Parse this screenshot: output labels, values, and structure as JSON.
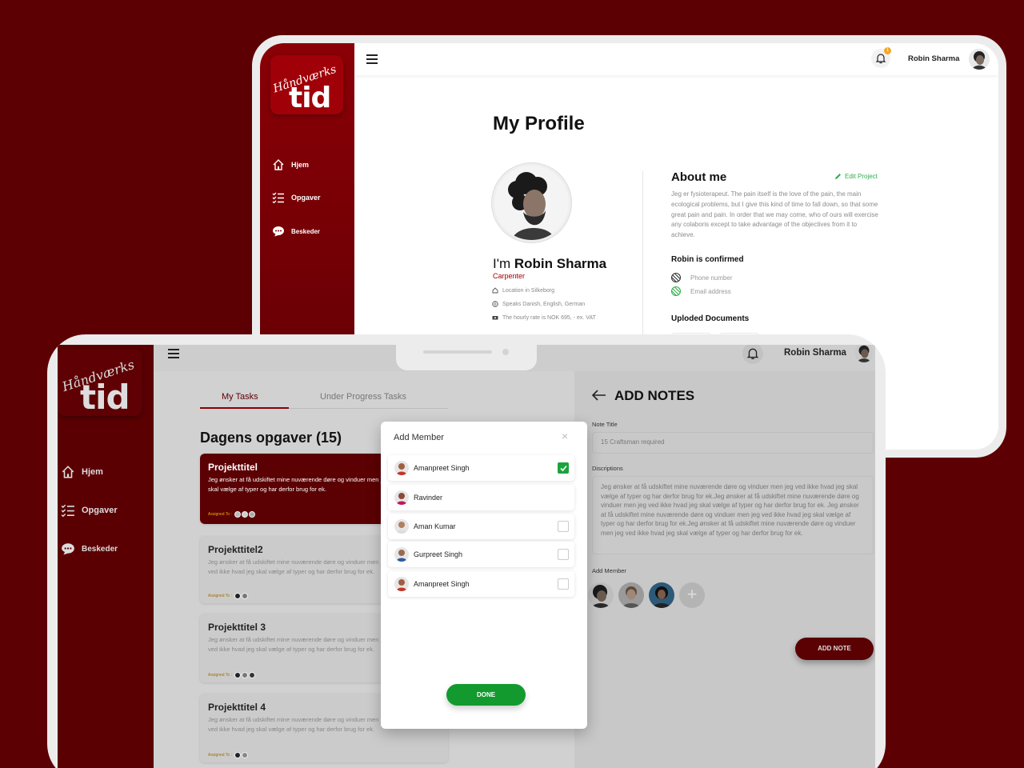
{
  "brand": {
    "script": "Håndværks",
    "big": "tid"
  },
  "nav": [
    {
      "label": "Hjem",
      "icon": "home-icon"
    },
    {
      "label": "Opgaver",
      "icon": "checklist-icon"
    },
    {
      "label": "Beskeder",
      "icon": "chat-icon"
    }
  ],
  "header": {
    "user_name": "Robin  Sharma",
    "notification_count": "1"
  },
  "profile": {
    "title": "My Profile",
    "im_prefix": "I'm",
    "name": "Robin Sharma",
    "role": "Carpenter",
    "location": "Location in Silkeborg",
    "languages": "Speaks Danish, English, German",
    "rate": "The hourly rate is NOK 695, - ex. VAT",
    "about_heading": "About me",
    "edit_label": "Edit Project",
    "about_text": "Jeg er fysioterapeut. The pain itself is the love of the pain, the main ecological problems, but I give this kind of time to fall down, so that some great pain and pain. In order that we may come, who of ours will exercise any colaboris except to take advantage of the objectives from it to achieve.",
    "confirmed_heading": "Robin is confirmed",
    "phone_label": "Phone number",
    "email_label": "Email address",
    "docs_heading": "Uploded Documents"
  },
  "tasks": {
    "tabs": [
      "My Tasks",
      "Under Progress Tasks"
    ],
    "heading": "Dagens opgaver (15)",
    "assigned_label": "Assigned To :",
    "cards": [
      {
        "title": "Projekttitel",
        "desc": "Jeg ønsker at få udskiftet mine nuværende døre og vinduer men jeg ved ikke hvad jeg skal vælge af typer og har  derfor brug for ek."
      },
      {
        "title": "Projekttitel2",
        "desc": "Jeg ønsker at få udskiftet mine nuværende døre og vinduer men jeg ved ikke hvad jeg skal vælge af typer og har  derfor brug for ek."
      },
      {
        "title": "Projekttitel 3",
        "desc": "Jeg ønsker at få udskiftet mine nuværende døre og vinduer men jeg ved ikke hvad jeg skal vælge af typer og har  derfor brug for ek."
      },
      {
        "title": "Projekttitel 4",
        "desc": "Jeg ønsker at få udskiftet mine nuværende døre og vinduer men jeg ved ikke hvad jeg skal vælge af typer og har  derfor brug for ek."
      }
    ]
  },
  "notes": {
    "heading": "ADD NOTES",
    "title_label": "Note Title",
    "title_value": "15 Craftsman required",
    "desc_label": "Discriptions",
    "desc_value": "Jeg ønsker at få udskiftet mine nuværende døre og  vinduer men jeg ved ikke hvad jeg skal vælge af  typer og har  derfor brug for ek.Jeg ønsker at få udskiftet mine nuværende døre og  vinduer men jeg ved ikke hvad jeg skal vælge af  typer og har  derfor brug for ek. Jeg ønsker at få udskiftet mine nuværende døre og  vinduer men jeg ved ikke hvad jeg skal vælge af  typer og har  derfor brug for ek.Jeg ønsker at få udskiftet mine nuværende døre og  vinduer men jeg ved ikke hvad jeg skal vælge af  typer og har  derfor brug for ek.",
    "member_label": "Add Member",
    "add_plus": "+",
    "button": "ADD NOTE"
  },
  "modal": {
    "title": "Add Member",
    "close": "×",
    "members": [
      {
        "name": "Amanpreet Singh",
        "checked": true
      },
      {
        "name": "Ravinder",
        "checked": false
      },
      {
        "name": "Aman Kumar",
        "checked": false
      },
      {
        "name": "Gurpreet Singh",
        "checked": false
      },
      {
        "name": "Amanpreet Singh",
        "checked": false
      }
    ],
    "done": "DONE"
  },
  "colors": {
    "brand_red": "#8a0006",
    "dark_red": "#5b0003",
    "green": "#129a2e",
    "badge": "#f5a623"
  }
}
